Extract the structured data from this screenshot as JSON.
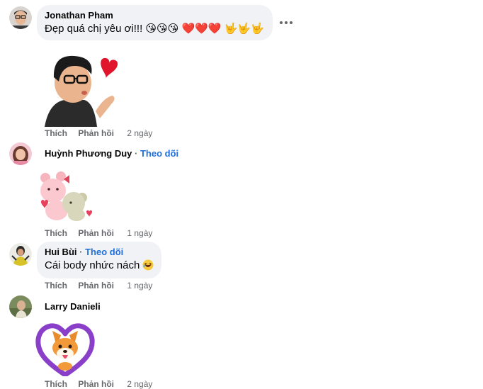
{
  "comments": [
    {
      "author": "Jonathan Pham",
      "text": "Đẹp quá chị yêu ơi!!! 😘😘😘 ❤️❤️❤️ 🤟🤟🤟",
      "actions": {
        "like": "Thích",
        "reply": "Phản hồi",
        "time": "2 ngày"
      },
      "avatar_icon": "avatar-man-glasses",
      "sticker_icon": "avatar-blowing-kiss-sticker"
    },
    {
      "author": "Huỳnh Phương Duy",
      "follow": "Theo dõi",
      "separator": "·",
      "actions": {
        "like": "Thích",
        "reply": "Phản hồi",
        "time": "1 ngày"
      },
      "avatar_icon": "avatar-woman-pink",
      "sticker_icon": "bears-hug-sticker"
    },
    {
      "author": "Hui Bùi",
      "follow": "Theo dõi",
      "separator": "·",
      "text": "Cái body nhức nách",
      "emoji_icon": "laughing-emoji",
      "actions": {
        "like": "Thích",
        "reply": "Phản hồi",
        "time": "1 ngày"
      },
      "avatar_icon": "avatar-person-yellow"
    },
    {
      "author": "Larry Danieli",
      "actions": {
        "like": "Thích",
        "reply": "Phản hồi",
        "time": "2 ngày"
      },
      "avatar_icon": "avatar-man-outdoor",
      "sticker_icon": "corgi-heart-sticker"
    }
  ],
  "more_icon": "more-options-icon",
  "colors": {
    "bubble": "#f0f2f5",
    "link": "#216fdb",
    "meta": "#65676b",
    "text": "#050505"
  }
}
